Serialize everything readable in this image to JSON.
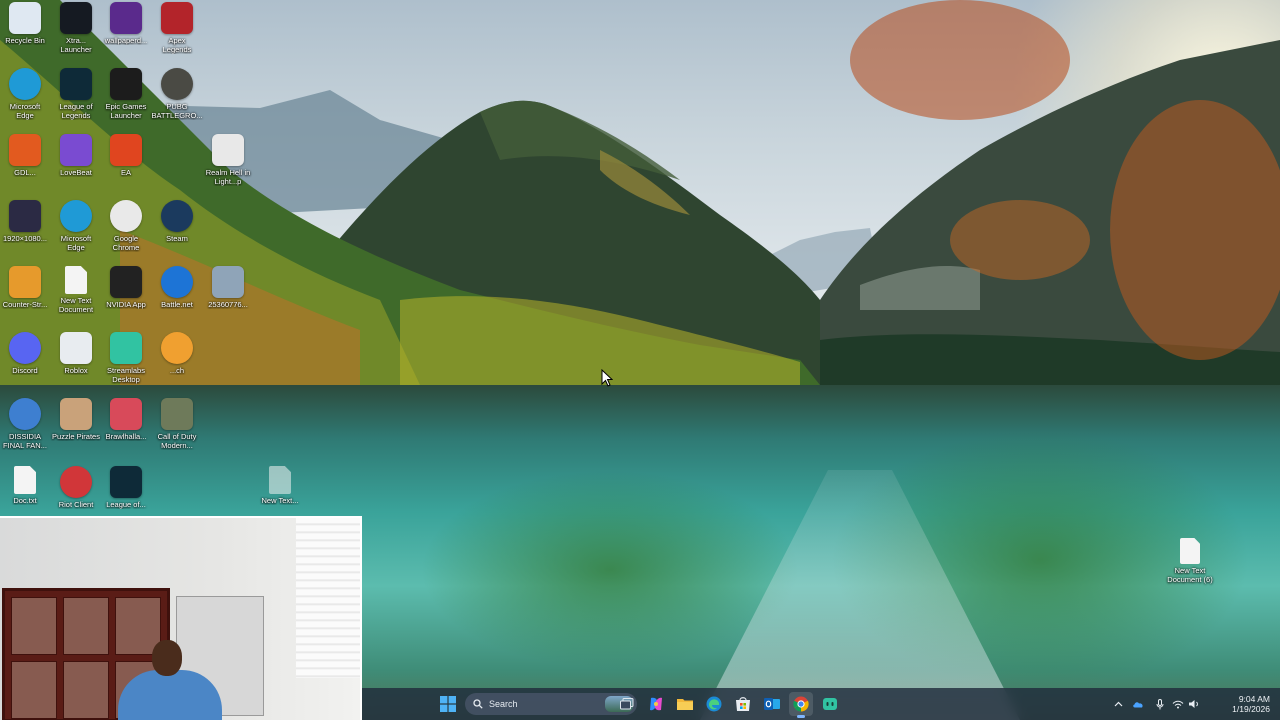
{
  "desktop": {
    "icons": [
      {
        "id": "recycle-bin",
        "label": "Recycle Bin",
        "icon": "recycle-bin-icon",
        "color": "#dfe8f2"
      },
      {
        "id": "x-app",
        "label": "Xtra...\nLauncher",
        "icon": "x-logo-icon",
        "color": "#151a22"
      },
      {
        "id": "wallpaper",
        "label": "wallpaperd...",
        "icon": "wallpaper-engine-icon",
        "color": "#5a2a8c"
      },
      {
        "id": "apex",
        "label": "Apex\nLegends",
        "icon": "apex-legends-icon",
        "color": "#b3242a"
      },
      {
        "id": "edge-1",
        "label": "Microsoft\nEdge",
        "icon": "edge-icon",
        "color": "#1f9ad6"
      },
      {
        "id": "league",
        "label": "League of\nLegends",
        "icon": "league-of-legends-icon",
        "color": "#0e2a38"
      },
      {
        "id": "epic",
        "label": "Epic Games\nLauncher",
        "icon": "epic-games-icon",
        "color": "#1c1c1c"
      },
      {
        "id": "pubg",
        "label": "PUBG\nBATTLEGRO...",
        "icon": "pubg-helmet-icon",
        "color": "#4a4a44"
      },
      {
        "id": "gdlauncher",
        "label": "GDL...",
        "icon": "launcher-hex-icon",
        "color": "#e25a1f"
      },
      {
        "id": "lovebeat",
        "label": "LoveBeat",
        "icon": "lovebeat-icon",
        "color": "#7a4bd1"
      },
      {
        "id": "ea",
        "label": "EA",
        "icon": "ea-icon",
        "color": "#e0451f"
      },
      {
        "id": "realm",
        "label": "Realm Hell in\nLight...p",
        "icon": "video-file-icon",
        "color": "#e8e8e8"
      },
      {
        "id": "res-file",
        "label": "1920×1080...",
        "icon": "image-file-icon",
        "color": "#2b2a44"
      },
      {
        "id": "edge-2",
        "label": "Microsoft\nEdge",
        "icon": "edge-icon",
        "color": "#1f9ad6"
      },
      {
        "id": "chrome",
        "label": "Google\nChrome",
        "icon": "chrome-icon",
        "color": "#e9e9e9"
      },
      {
        "id": "steam",
        "label": "Steam",
        "icon": "steam-icon",
        "color": "#1b3a5e"
      },
      {
        "id": "cs",
        "label": "Counter-Str...",
        "icon": "counter-strike-icon",
        "color": "#e69a2c"
      },
      {
        "id": "new-text-1",
        "label": "New Text\nDocument",
        "icon": "text-document-icon",
        "color": "#f4f4f4"
      },
      {
        "id": "nvidia",
        "label": "NVIDIA App",
        "icon": "nvidia-icon",
        "color": "#222222"
      },
      {
        "id": "battlenet",
        "label": "Battle.net",
        "icon": "battlenet-icon",
        "color": "#1d74d6"
      },
      {
        "id": "photo",
        "label": "25360776...",
        "icon": "photo-file-icon",
        "color": "#8fa4b8"
      },
      {
        "id": "discord",
        "label": "Discord",
        "icon": "discord-icon",
        "color": "#5865f2"
      },
      {
        "id": "roblox",
        "label": "Roblox",
        "icon": "roblox-icon",
        "color": "#e8ecf0"
      },
      {
        "id": "streamlabs",
        "label": "Streamlabs\nDesktop",
        "icon": "streamlabs-icon",
        "color": "#31c3a2"
      },
      {
        "id": "overwatch",
        "label": "...ch",
        "icon": "overwatch-icon",
        "color": "#f0a030"
      },
      {
        "id": "dissidia",
        "label": "DISSIDIA\nFINAL FAN...",
        "icon": "globe-icon",
        "color": "#3e7fd0"
      },
      {
        "id": "puzzle-pirates",
        "label": "Puzzle Pirates",
        "icon": "pirate-icon",
        "color": "#c9a27a"
      },
      {
        "id": "brawl",
        "label": "Brawlhalla...",
        "icon": "brawl-icon",
        "color": "#d84a5a"
      },
      {
        "id": "cod",
        "label": "Call of Duty\nModern...",
        "icon": "call-of-duty-icon",
        "color": "#6e7a5a"
      },
      {
        "id": "doc",
        "label": "Doc.txt",
        "icon": "text-document-icon",
        "color": "#f4f4f4"
      },
      {
        "id": "riot",
        "label": "Riot Client",
        "icon": "riot-client-icon",
        "color": "#d13639"
      },
      {
        "id": "league-2",
        "label": "League of...",
        "icon": "league-of-legends-icon",
        "color": "#0e2a38"
      },
      {
        "id": "new-text-2",
        "label": "New Text...",
        "icon": "text-document-icon",
        "color": "#f4f4f4"
      }
    ],
    "loose_file": {
      "label_line1": "New Text",
      "label_line2": "Document (6)",
      "icon": "text-document-icon"
    }
  },
  "taskbar": {
    "search_placeholder": "Search",
    "apps": [
      {
        "id": "start",
        "icon": "windows-start-icon",
        "active": false
      },
      {
        "id": "task-view",
        "icon": "task-view-icon",
        "active": false
      },
      {
        "id": "copilot",
        "icon": "copilot-icon",
        "active": false
      },
      {
        "id": "explorer",
        "icon": "file-explorer-icon",
        "active": false
      },
      {
        "id": "edge",
        "icon": "edge-icon",
        "active": false
      },
      {
        "id": "store",
        "icon": "microsoft-store-icon",
        "active": false
      },
      {
        "id": "outlook",
        "icon": "outlook-icon",
        "active": false
      },
      {
        "id": "chrome",
        "icon": "chrome-icon",
        "active": true
      },
      {
        "id": "streamlabs",
        "icon": "streamlabs-icon",
        "active": false
      }
    ],
    "tray": {
      "time": "9:04 AM",
      "date": "1/19/2026",
      "icons": [
        "chevron-up-icon",
        "onedrive-cloud-icon",
        "microphone-icon",
        "wifi-icon",
        "speaker-icon"
      ]
    }
  },
  "colors": {
    "taskbar_bg": "#202c3c",
    "active_indicator": "#7fb6ff"
  }
}
